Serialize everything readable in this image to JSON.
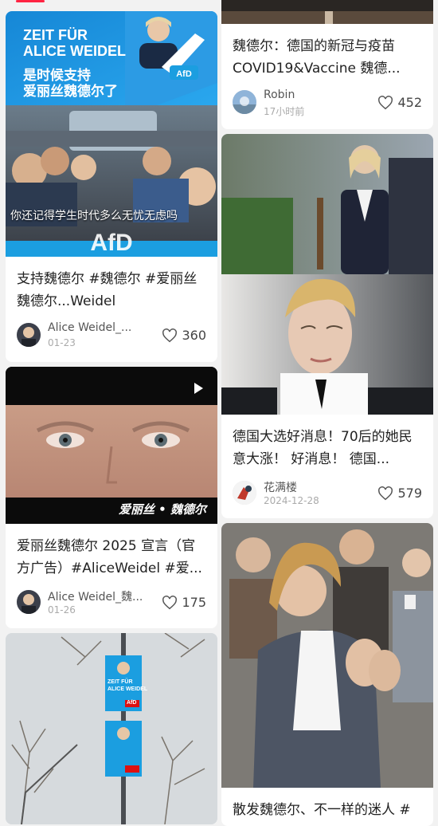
{
  "left_cards": [
    {
      "poster_line1": "ZEIT FÜR",
      "poster_line2": "ALICE WEIDEL",
      "poster_caption1": "是时候支持",
      "poster_caption2": "爱丽丝魏德尔了",
      "bus_caption": "你还记得学生时代多么无忧无虑吗",
      "afd_logo": "AfD",
      "title": "支持魏德尔 #魏德尔 #爱丽丝魏德尔...Weidel",
      "author": "Alice Weidel_...",
      "date": "01-23",
      "likes": "360"
    },
    {
      "video_caption": "爱丽丝 • 魏德尔",
      "title": "爱丽丝魏德尔 2025 宣言（官方广告）#AliceWeidel #爱...",
      "author": "Alice Weidel_魏...",
      "date": "01-26",
      "likes": "175"
    },
    {
      "poster_line1": "ZEIT FÜR",
      "poster_line2": "ALICE WEIDEL",
      "afd_logo": "AfD"
    }
  ],
  "right_cards": [
    {
      "title": "魏德尔：德国的新冠与疫苗COVID19&Vaccine 魏德...",
      "author": "Robin",
      "date": "17小时前",
      "likes": "452"
    },
    {
      "title": "德国大选好消息！70后的她民意大涨！ 好消息！ 德国...",
      "author": "花满楼",
      "date": "2024-12-28",
      "likes": "579"
    },
    {
      "title": "散发魏德尔、不一样的迷人 #"
    }
  ],
  "colors": {
    "accent": "#ff2442",
    "afd_blue": "#1b9ee0",
    "text": "#222222",
    "meta": "#555555"
  },
  "icons": [
    "heart-icon",
    "play-icon",
    "avatar"
  ]
}
